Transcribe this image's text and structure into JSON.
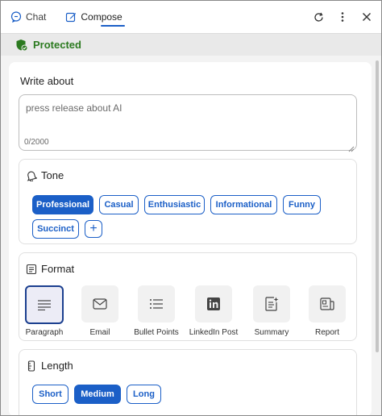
{
  "tabs": {
    "chat_label": "Chat",
    "compose_label": "Compose"
  },
  "icons": {
    "chat": "chat-bubble-icon",
    "compose": "compose-pen-icon",
    "refresh": "refresh-icon",
    "more": "more-vertical-icon",
    "close": "close-icon",
    "shield": "shield-check-icon"
  },
  "banner": {
    "text": "Protected"
  },
  "write": {
    "label": "Write about",
    "value": "press release about AI",
    "counter": "0/2000"
  },
  "tone": {
    "title": "Tone",
    "options": [
      {
        "label": "Professional",
        "selected": true
      },
      {
        "label": "Casual",
        "selected": false
      },
      {
        "label": "Enthusiastic",
        "selected": false
      },
      {
        "label": "Informational",
        "selected": false
      },
      {
        "label": "Funny",
        "selected": false
      },
      {
        "label": "Succinct",
        "selected": false
      }
    ],
    "add_label": "+"
  },
  "format": {
    "title": "Format",
    "options": [
      {
        "label": "Paragraph",
        "icon": "paragraph-icon",
        "selected": true
      },
      {
        "label": "Email",
        "icon": "email-icon",
        "selected": false
      },
      {
        "label": "Bullet Points",
        "icon": "bullet-list-icon",
        "selected": false
      },
      {
        "label": "LinkedIn Post",
        "icon": "linkedin-icon",
        "selected": false
      },
      {
        "label": "Summary",
        "icon": "summary-icon",
        "selected": false
      },
      {
        "label": "Report",
        "icon": "report-icon",
        "selected": false
      }
    ]
  },
  "length": {
    "title": "Length",
    "options": [
      {
        "label": "Short",
        "selected": false
      },
      {
        "label": "Medium",
        "selected": true
      },
      {
        "label": "Long",
        "selected": false
      }
    ]
  },
  "colors": {
    "accent": "#1b5fc7",
    "protected": "#2b7a1f",
    "selected_border": "#1b3f8f"
  }
}
